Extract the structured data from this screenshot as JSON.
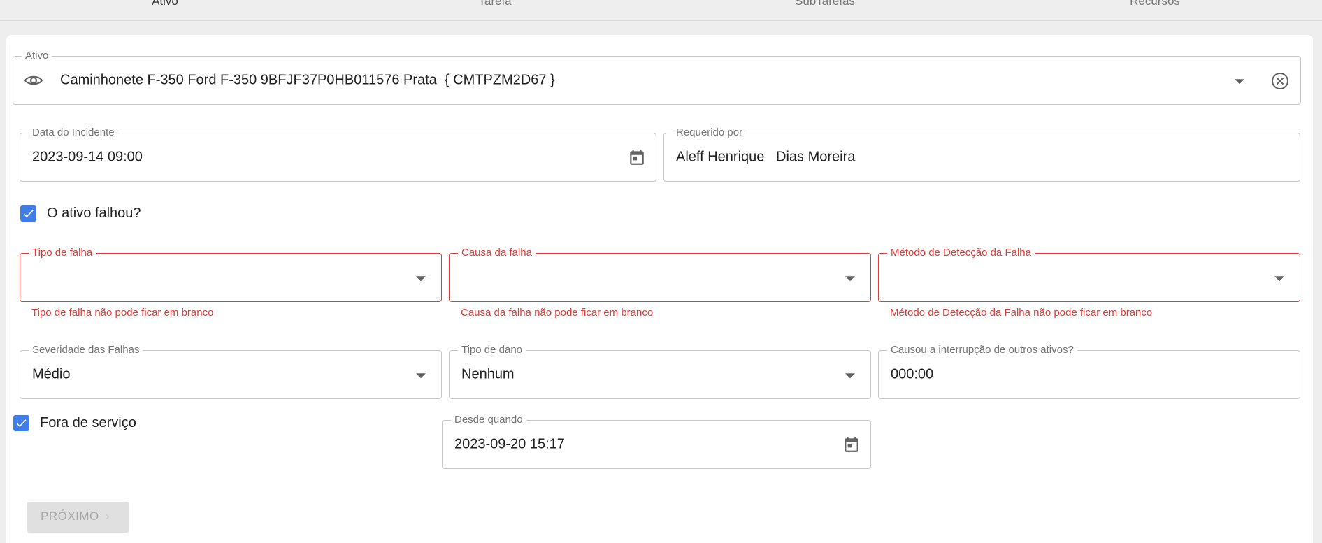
{
  "tabs": [
    "Ativo",
    "Tarefa",
    "SubTarefas",
    "Recursos"
  ],
  "asset": {
    "label": "Ativo",
    "value": "Caminhonete F-350 Ford F-350 9BFJF37P0HB011576 Prata  { CMTPZM2D67 }"
  },
  "incident_date": {
    "label": "Data do Incidente",
    "value": "2023-09-14 09:00"
  },
  "requested_by": {
    "label": "Requerido por",
    "value": "Aleff Henrique   Dias Moreira"
  },
  "asset_failed": {
    "label": "O ativo falhou?",
    "checked": true
  },
  "failure_type": {
    "label": "Tipo de falha",
    "value": "",
    "error": "Tipo de falha não pode ficar em branco"
  },
  "failure_cause": {
    "label": "Causa da falha",
    "value": "",
    "error": "Causa da falha não pode ficar em branco"
  },
  "detection_method": {
    "label": "Método de Detecção da Falha",
    "value": "",
    "error": "Método de Detecção da Falha não pode ficar em branco"
  },
  "severity": {
    "label": "Severidade das Falhas",
    "value": "Médio"
  },
  "damage_type": {
    "label": "Tipo de dano",
    "value": "Nenhum"
  },
  "interruption": {
    "label": "Causou a interrupção de outros ativos?",
    "value": "000:00"
  },
  "out_of_service": {
    "label": "Fora de serviço",
    "checked": true
  },
  "since_when": {
    "label": "Desde quando",
    "value": "2023-09-20 15:17"
  },
  "next_button": {
    "label": "PRÓXIMO",
    "chevron": "›"
  },
  "colors": {
    "accent": "#3f7ee8",
    "error": "#e53935"
  },
  "icons": {
    "eye": "eye-icon",
    "clear": "clear-circle-icon",
    "calendar": "calendar-icon",
    "dropdown": "dropdown-arrow-icon",
    "check": "check-icon"
  }
}
